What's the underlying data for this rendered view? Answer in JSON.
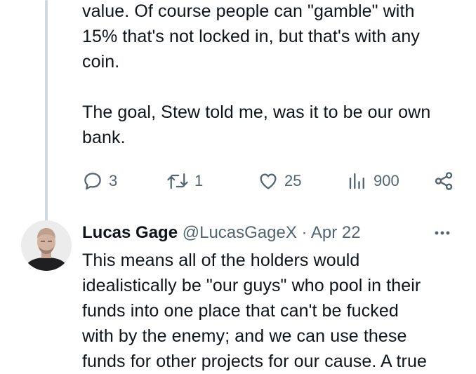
{
  "tweet1": {
    "text": "value. Of course people can \"gamble\" with\n15% that's not locked in, but that's with any\ncoin.\n\nThe goal, Stew told me, was it to be our own\nbank.",
    "counts": {
      "replies": "3",
      "retweets": "1",
      "likes": "25",
      "views": "900"
    },
    "icons": {
      "reply": "reply-icon",
      "retweet": "retweet-icon",
      "like": "heart-icon",
      "views": "views-icon",
      "share": "share-icon"
    }
  },
  "tweet2": {
    "author_name": "Lucas Gage",
    "handle": "@LucasGageX",
    "separator": "·",
    "date": "Apr 22",
    "text": "This means all of the holders would\nidealistically be \"our guys\" who pool in their\nfunds into one place that can't be fucked\nwith by the enemy; and we can use these\nfunds for other projects for our cause. A true",
    "icons": {
      "more": "more-icon"
    }
  },
  "colors": {
    "text": "#0f1419",
    "secondary": "#536471",
    "thread_line": "#cfd9de",
    "background": "#ffffff"
  }
}
